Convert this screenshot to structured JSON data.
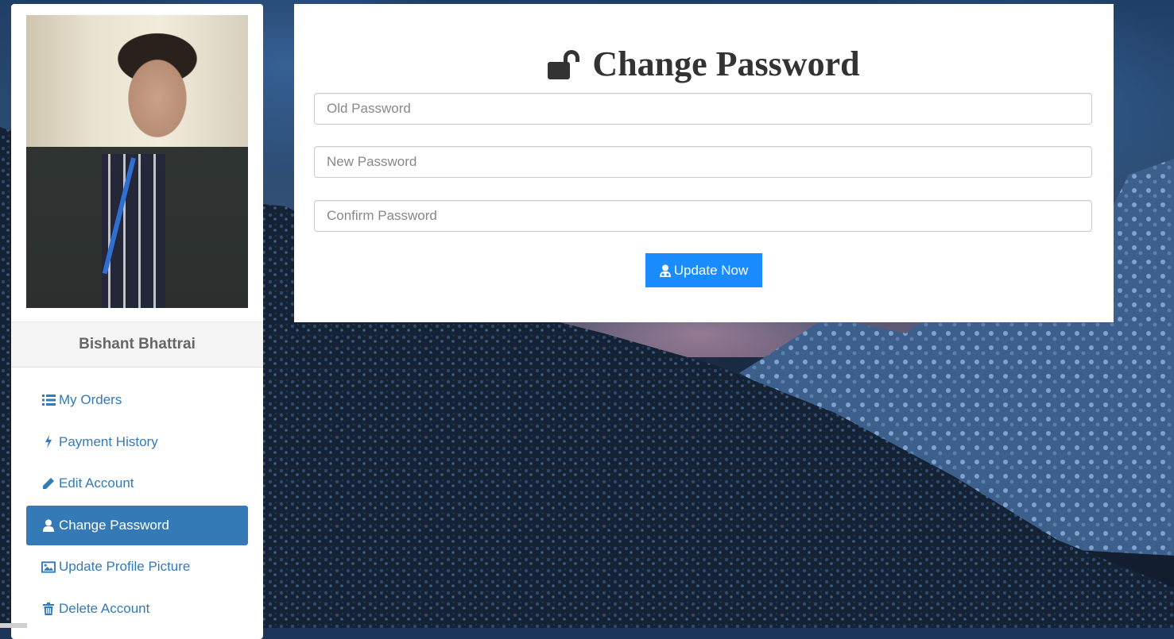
{
  "sidebar": {
    "profile_name": "Bishant Bhattrai",
    "items": [
      {
        "label": "My Orders",
        "icon": "list-icon",
        "active": false
      },
      {
        "label": "Payment History",
        "icon": "bolt-icon",
        "active": false
      },
      {
        "label": "Edit Account",
        "icon": "pencil-icon",
        "active": false
      },
      {
        "label": "Change Password",
        "icon": "user-icon",
        "active": true
      },
      {
        "label": "Update Profile Picture",
        "icon": "picture-icon",
        "active": false
      },
      {
        "label": "Delete Account",
        "icon": "trash-icon",
        "active": false
      }
    ]
  },
  "form": {
    "title": "Change Password",
    "title_icon": "unlock-icon",
    "old_password": {
      "placeholder": "Old Password",
      "value": ""
    },
    "new_password": {
      "placeholder": "New Password",
      "value": ""
    },
    "confirm_password": {
      "placeholder": "Confirm Password",
      "value": ""
    },
    "submit_label": "Update Now",
    "submit_icon": "user-md-icon"
  },
  "colors": {
    "link": "#337ab7",
    "active_bg": "#337ab7",
    "button": "#1a8cff"
  }
}
